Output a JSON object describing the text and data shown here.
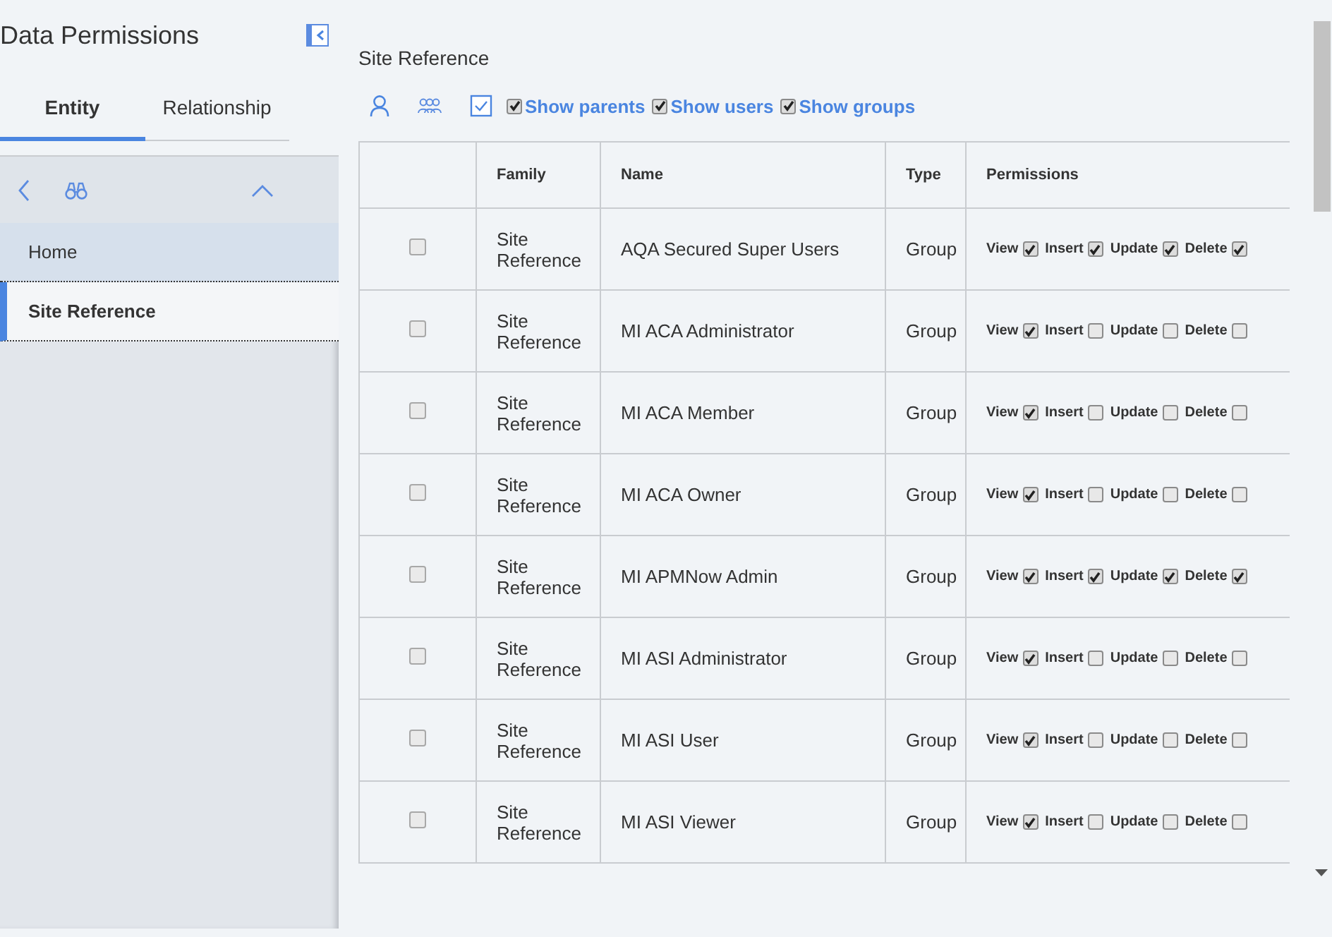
{
  "sidebar": {
    "title": "Data Permissions",
    "tabs": [
      {
        "label": "Entity",
        "selected": true
      },
      {
        "label": "Relationship",
        "selected": false
      }
    ],
    "tree": [
      {
        "label": "Home",
        "selected": false
      },
      {
        "label": "Site Reference",
        "selected": true
      }
    ]
  },
  "main": {
    "title": "Site Reference",
    "filters": [
      {
        "label": "Show parents",
        "checked": true
      },
      {
        "label": "Show users",
        "checked": true
      },
      {
        "label": "Show groups",
        "checked": true
      }
    ],
    "table": {
      "columns": [
        "Family",
        "Name",
        "Type",
        "Permissions"
      ],
      "rows": [
        {
          "selected": false,
          "family": "Site Reference",
          "name": "AQA Secured Super Users",
          "type": "Group",
          "permissions": [
            {
              "label": "View",
              "checked": true
            },
            {
              "label": "Insert",
              "checked": true
            },
            {
              "label": "Update",
              "checked": true
            },
            {
              "label": "Delete",
              "checked": true
            }
          ]
        },
        {
          "selected": false,
          "family": "Site Reference",
          "name": "MI ACA Administrator",
          "type": "Group",
          "permissions": [
            {
              "label": "View",
              "checked": true
            },
            {
              "label": "Insert",
              "checked": false
            },
            {
              "label": "Update",
              "checked": false
            },
            {
              "label": "Delete",
              "checked": false
            }
          ]
        },
        {
          "selected": false,
          "family": "Site Reference",
          "name": "MI ACA Member",
          "type": "Group",
          "permissions": [
            {
              "label": "View",
              "checked": true
            },
            {
              "label": "Insert",
              "checked": false
            },
            {
              "label": "Update",
              "checked": false
            },
            {
              "label": "Delete",
              "checked": false
            }
          ]
        },
        {
          "selected": false,
          "family": "Site Reference",
          "name": "MI ACA Owner",
          "type": "Group",
          "permissions": [
            {
              "label": "View",
              "checked": true
            },
            {
              "label": "Insert",
              "checked": false
            },
            {
              "label": "Update",
              "checked": false
            },
            {
              "label": "Delete",
              "checked": false
            }
          ]
        },
        {
          "selected": false,
          "family": "Site Reference",
          "name": "MI APMNow Admin",
          "type": "Group",
          "permissions": [
            {
              "label": "View",
              "checked": true
            },
            {
              "label": "Insert",
              "checked": true
            },
            {
              "label": "Update",
              "checked": true
            },
            {
              "label": "Delete",
              "checked": true
            }
          ]
        },
        {
          "selected": false,
          "family": "Site Reference",
          "name": "MI ASI Administrator",
          "type": "Group",
          "permissions": [
            {
              "label": "View",
              "checked": true
            },
            {
              "label": "Insert",
              "checked": false
            },
            {
              "label": "Update",
              "checked": false
            },
            {
              "label": "Delete",
              "checked": false
            }
          ]
        },
        {
          "selected": false,
          "family": "Site Reference",
          "name": "MI ASI User",
          "type": "Group",
          "permissions": [
            {
              "label": "View",
              "checked": true
            },
            {
              "label": "Insert",
              "checked": false
            },
            {
              "label": "Update",
              "checked": false
            },
            {
              "label": "Delete",
              "checked": false
            }
          ]
        },
        {
          "selected": false,
          "family": "Site Reference",
          "name": "MI ASI Viewer",
          "type": "Group",
          "permissions": [
            {
              "label": "View",
              "checked": true
            },
            {
              "label": "Insert",
              "checked": false
            },
            {
              "label": "Update",
              "checked": false
            },
            {
              "label": "Delete",
              "checked": false
            }
          ]
        }
      ]
    }
  }
}
